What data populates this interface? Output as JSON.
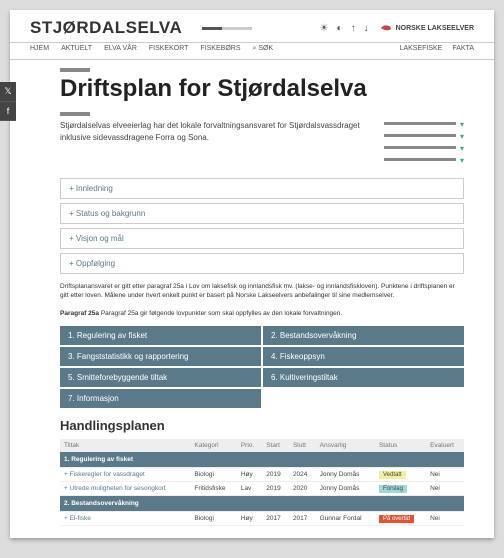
{
  "header": {
    "logo": "STJØRDALSELVA",
    "org": "NORSKE LAKSEELVER"
  },
  "nav": {
    "items": [
      "HJEM",
      "AKTUELT",
      "ELVA VÅR",
      "FISKEKORT",
      "FISKEBØRS",
      "SØK"
    ],
    "right": [
      "LAKSEFISKE",
      "FAKTA"
    ]
  },
  "title": "Driftsplan for Stjørdalselva",
  "intro": "Stjørdalselvas elveeierlag har det lokale forvaltningsansvaret for Stjørdalsvassdraget inklusive sidevassdragene Forra og Sona.",
  "accordion": [
    "+ Innledning",
    "+ Status og bakgrunn",
    "+ Visjon og mål",
    "+ Oppfølging"
  ],
  "note1": "Driftsplanansvaret er gitt etter paragraf 25a i Lov om laksefisk og innlandsfisk mv. (lakse- og innlandsfiskloven). Punktene i driftsplanen er gitt etter loven. Målene under hvert enkelt punkt er basert på Norske Lakseelvers anbefalinger til sine medlemselver.",
  "note2": "Paragraf 25a gir følgende lovpunkter som skal oppfylles av den lokale forvaltningen.",
  "categories": [
    "1. Regulering av fisket",
    "2. Bestandsovervåkning",
    "3. Fangststatistikk og rapportering",
    "4. Fiskeoppsyn",
    "5. Smitteforebyggende tiltak",
    "6. Kultiveringstiltak",
    "7. Informasjon"
  ],
  "hp_title": "Handlingsplanen",
  "table": {
    "headers": [
      "Tiltak",
      "Kategori",
      "Prio.",
      "Start",
      "Slutt",
      "Ansvarlig",
      "Status",
      "Evaluert"
    ],
    "sections": [
      {
        "title": "1. Regulering av fisket",
        "rows": [
          {
            "t": "+ Fiskeregler for vassdraget",
            "k": "Biologi",
            "p": "Høy",
            "s": "2019",
            "e": "2024",
            "a": "Jonny Domås",
            "st": "Vedtatt",
            "stc": "vedtatt",
            "ev": "Nei"
          },
          {
            "t": "+ Utrede muligheten for sesongkort",
            "k": "Fritidsfiske",
            "p": "Lav",
            "s": "2019",
            "e": "2020",
            "a": "Jonny Domås",
            "st": "Forslag",
            "stc": "forslag",
            "ev": "Nei"
          }
        ]
      },
      {
        "title": "2. Bestandsovervåkning",
        "rows": [
          {
            "t": "+ El-fiske",
            "k": "Biologi",
            "p": "Høy",
            "s": "2017",
            "e": "2017",
            "a": "Gunnar Fordal",
            "st": "På overtid",
            "stc": "overstid",
            "ev": "Nei"
          }
        ]
      }
    ]
  }
}
